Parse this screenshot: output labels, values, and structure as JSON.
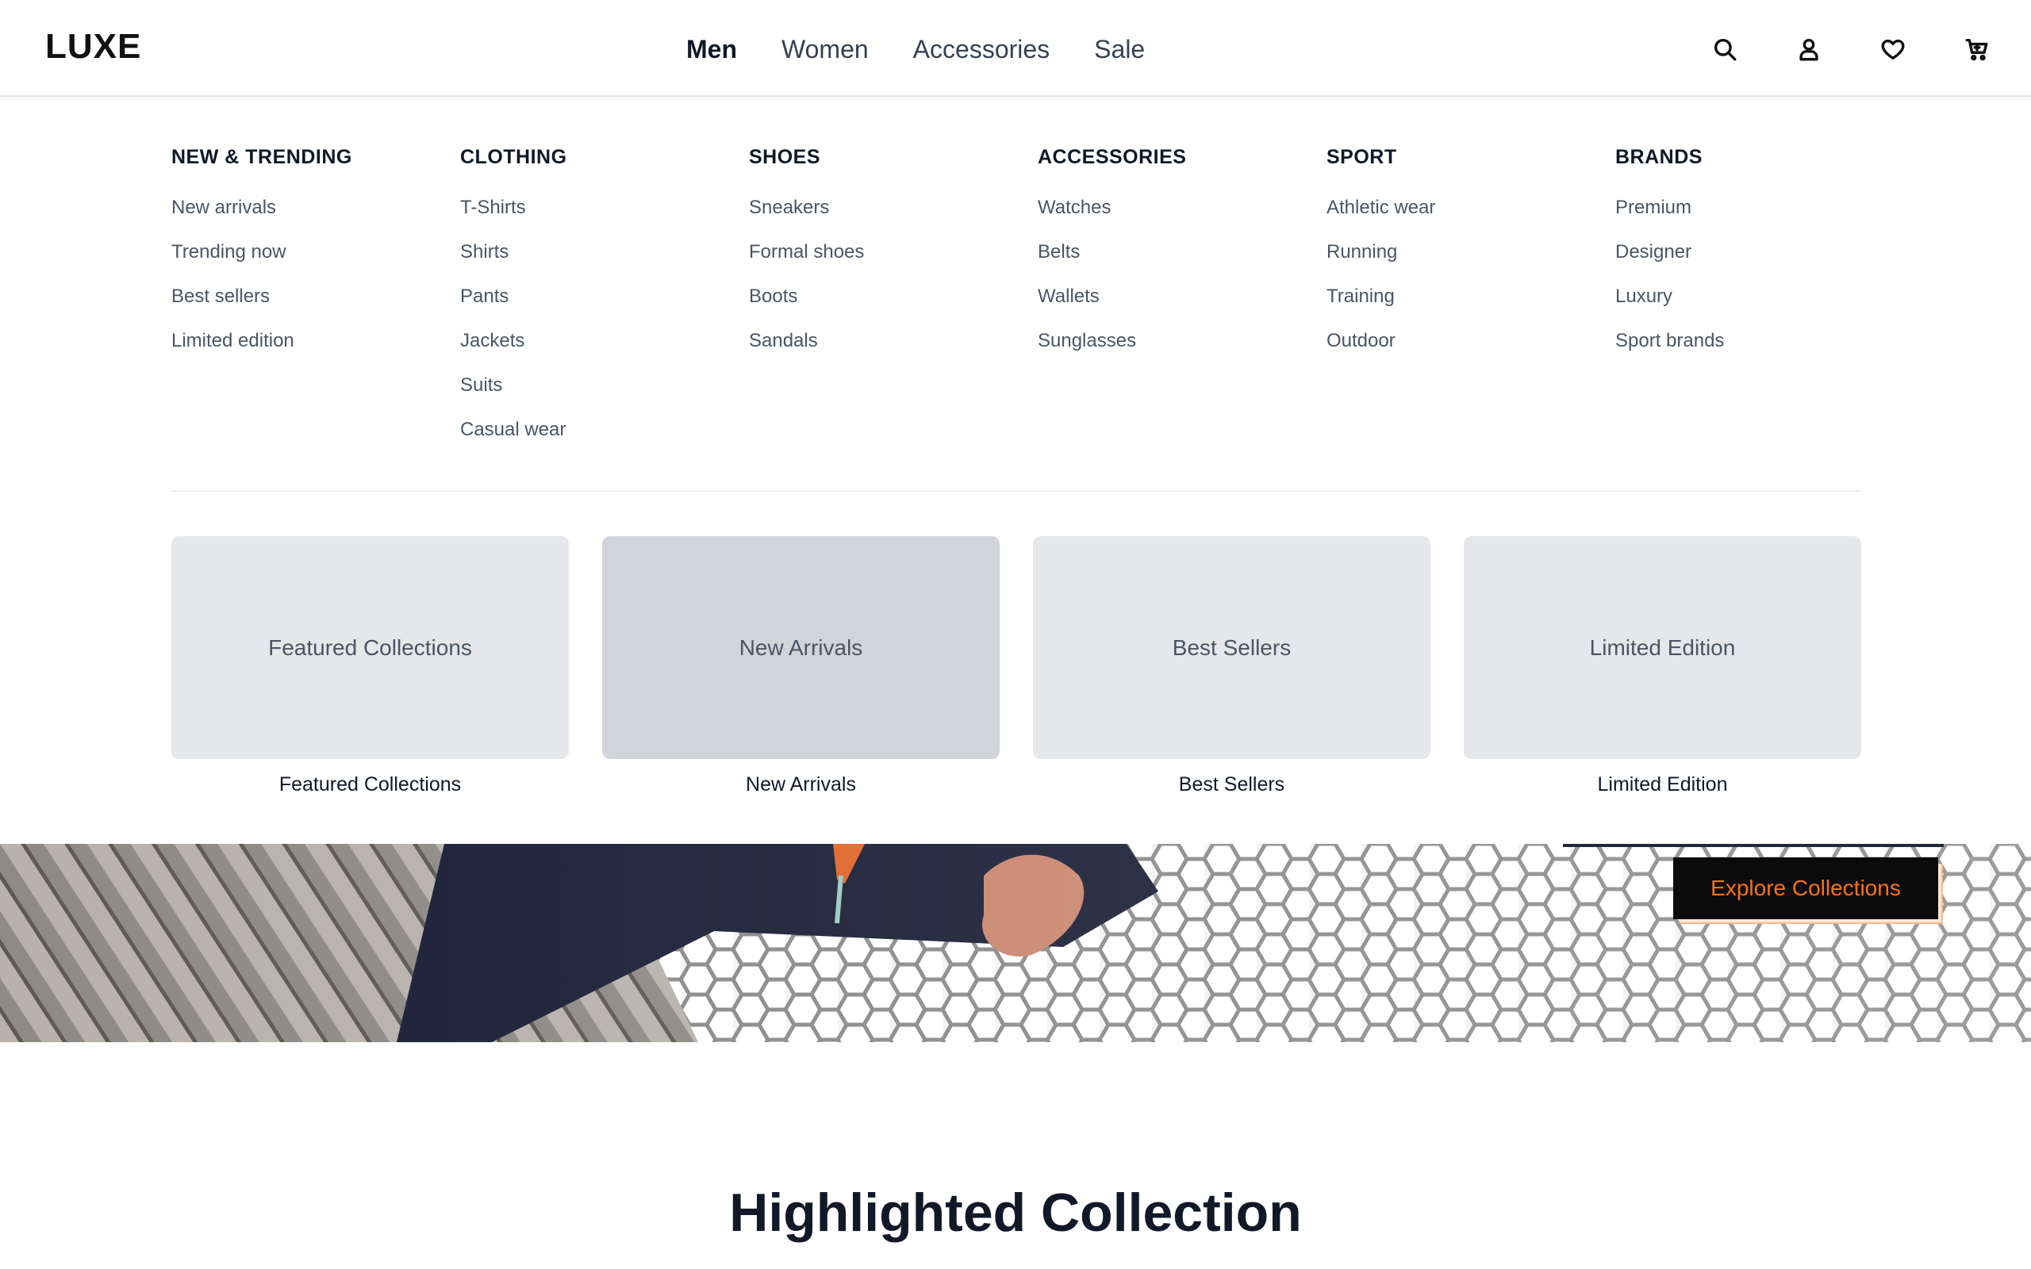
{
  "header": {
    "logo": "LUXE",
    "nav": [
      "Men",
      "Women",
      "Accessories",
      "Sale"
    ],
    "active_nav": "Men",
    "icons": [
      "search-icon",
      "user-icon",
      "heart-icon",
      "cart-icon"
    ]
  },
  "mega_menu": {
    "columns": [
      {
        "title": "NEW & TRENDING",
        "items": [
          "New arrivals",
          "Trending now",
          "Best sellers",
          "Limited edition"
        ]
      },
      {
        "title": "CLOTHING",
        "items": [
          "T-Shirts",
          "Shirts",
          "Pants",
          "Jackets",
          "Suits",
          "Casual wear"
        ]
      },
      {
        "title": "SHOES",
        "items": [
          "Sneakers",
          "Formal shoes",
          "Boots",
          "Sandals"
        ]
      },
      {
        "title": "ACCESSORIES",
        "items": [
          "Watches",
          "Belts",
          "Wallets",
          "Sunglasses"
        ]
      },
      {
        "title": "SPORT",
        "items": [
          "Athletic wear",
          "Running",
          "Training",
          "Outdoor"
        ]
      },
      {
        "title": "BRANDS",
        "items": [
          "Premium",
          "Designer",
          "Luxury",
          "Sport brands"
        ]
      }
    ],
    "cards": [
      {
        "label": "Featured Collections",
        "caption": "Featured Collections"
      },
      {
        "label": "New Arrivals",
        "caption": "New Arrivals"
      },
      {
        "label": "Best Sellers",
        "caption": "Best Sellers"
      },
      {
        "label": "Limited Edition",
        "caption": "Limited Edition"
      }
    ]
  },
  "hero": {
    "button_label": "Explore Collections"
  },
  "section": {
    "title": "Highlighted Collection"
  },
  "colors": {
    "accent": "#f97316",
    "text": "#111827",
    "muted": "#4b5563",
    "card_bg": "#e5e7eb",
    "card_hover_bg": "#d1d5db"
  }
}
